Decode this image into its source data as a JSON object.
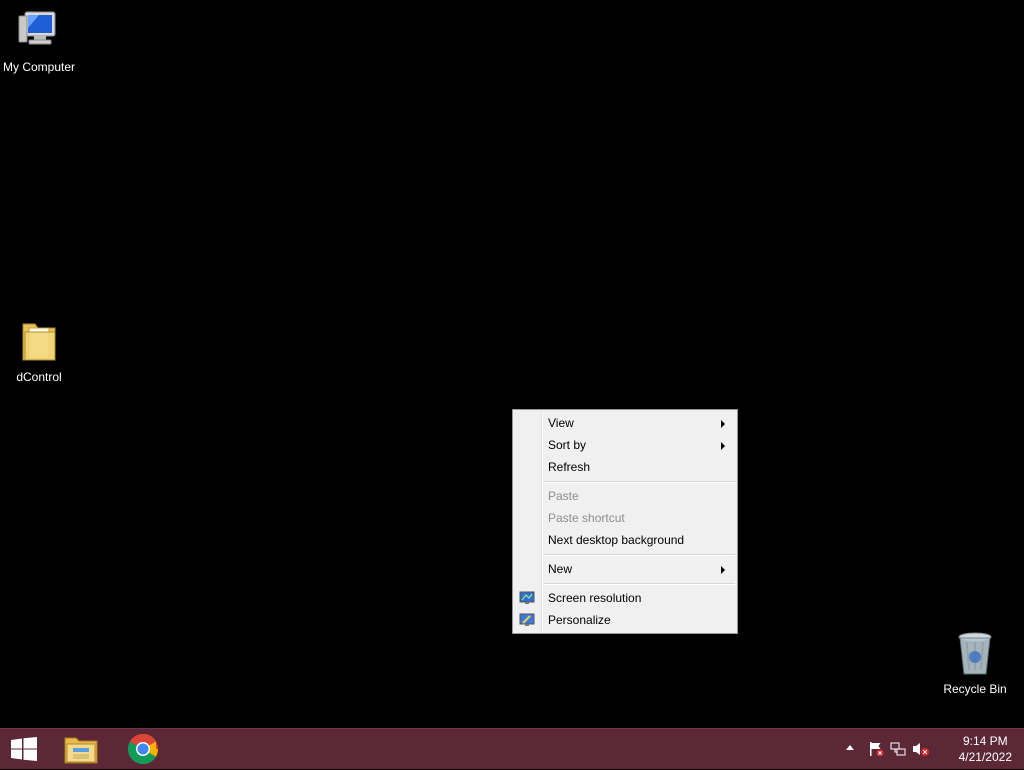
{
  "desktop": {
    "icons": [
      {
        "label": "My Computer"
      },
      {
        "label": "dControl"
      },
      {
        "label": "Recycle Bin"
      }
    ]
  },
  "context_menu": {
    "items": [
      {
        "label": "View",
        "has_submenu": true
      },
      {
        "label": "Sort by",
        "has_submenu": true
      },
      {
        "label": "Refresh"
      },
      {
        "label": "Paste",
        "disabled": true
      },
      {
        "label": "Paste shortcut",
        "disabled": true
      },
      {
        "label": "Next desktop background"
      },
      {
        "label": "New",
        "has_submenu": true
      },
      {
        "label": "Screen resolution",
        "icon": "display-icon"
      },
      {
        "label": "Personalize",
        "icon": "personalize-icon"
      }
    ]
  },
  "taskbar": {
    "apps": [
      {
        "icon": "windows-start-icon"
      },
      {
        "icon": "file-explorer-icon"
      },
      {
        "icon": "chrome-icon"
      }
    ],
    "tray": {
      "icons": [
        "show-hidden-icons-arrow",
        "action-center-flag-icon",
        "network-icon",
        "volume-muted-icon"
      ],
      "time": "9:14 PM",
      "date": "4/21/2022"
    }
  },
  "colors": {
    "desktop_bg": "#000000",
    "taskbar_bg": "#5c2838",
    "menu_bg": "#f0f0f0"
  }
}
